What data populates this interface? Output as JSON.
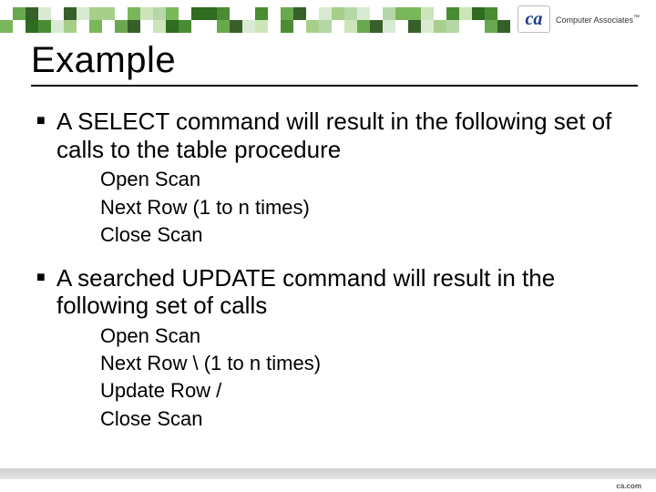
{
  "brand": {
    "mark": "ca",
    "name": "Computer Associates",
    "tm": "™"
  },
  "title": "Example",
  "bullets": [
    {
      "text": "A SELECT command will result in the following set of calls to the table procedure",
      "sub": [
        "Open Scan",
        "Next Row (1 to n times)",
        "Close Scan"
      ]
    },
    {
      "text": "A searched UPDATE command will result in the following set of calls",
      "sub": [
        "Open Scan",
        "Next Row    \\   (1 to n times)",
        "Update Row   /",
        "Close Scan"
      ]
    }
  ],
  "footer": "ca.com",
  "palette": {
    "band_colors": [
      "#2f6b20",
      "#6aa84f",
      "#a8cf8a",
      "#cde5b8",
      "#ffffff",
      "#d9ead3",
      "#7ab65a",
      "#498c33",
      "#375f2a",
      "#b6d7a8"
    ]
  }
}
